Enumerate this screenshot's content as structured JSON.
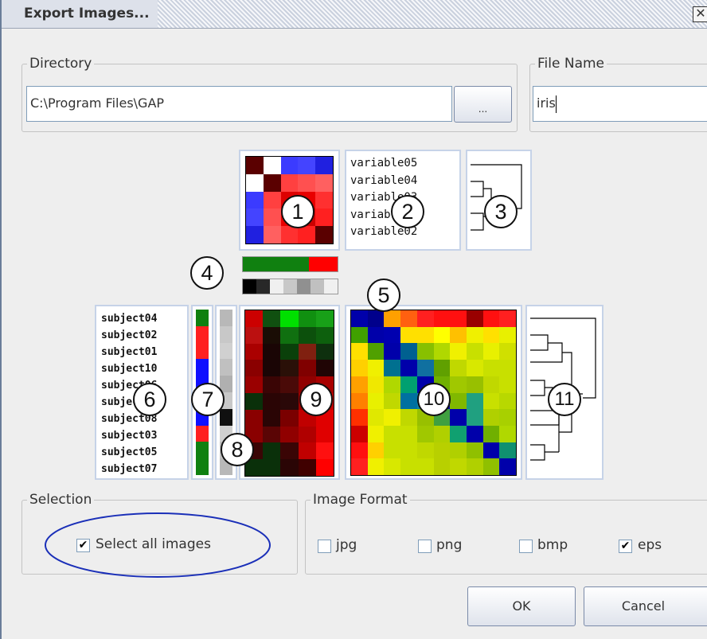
{
  "window": {
    "title": "Export Images...",
    "close_glyph": "✕"
  },
  "directory": {
    "group_label": "Directory",
    "value": "C:\\Program Files\\GAP",
    "browse_label": "..."
  },
  "file_name": {
    "group_label": "File Name",
    "value": "iris"
  },
  "preview": {
    "callouts": [
      "1",
      "2",
      "3",
      "4",
      "5",
      "6",
      "7",
      "8",
      "9",
      "10",
      "11"
    ],
    "variable_labels": [
      "variable05",
      "variable04",
      "variable03",
      "variable01",
      "variable02"
    ],
    "subject_labels": [
      "subject04",
      "subject02",
      "subject01",
      "subject10",
      "subject06",
      "subject09",
      "subject08",
      "subject03",
      "subject05",
      "subject07"
    ],
    "variable_matrix": [
      [
        "#5a0000",
        "#ffffff",
        "#3b3bff",
        "#4444ff",
        "#2020e0"
      ],
      [
        "#ffffff",
        "#5a0000",
        "#ff4040",
        "#ff5050",
        "#ff6060"
      ],
      [
        "#3b3bff",
        "#ff4040",
        "#dd0000",
        "#e80000",
        "#ff3030"
      ],
      [
        "#4444ff",
        "#ff5050",
        "#e80000",
        "#cc0000",
        "#ff2020"
      ],
      [
        "#2020e0",
        "#ff6060",
        "#ff3030",
        "#ff2020",
        "#5a0000"
      ]
    ],
    "color_bar_green_red": [
      "#108010",
      "#108010",
      "#108010",
      "#108010",
      "#108010",
      "#108010",
      "#108010",
      "#ff0000",
      "#ff0000",
      "#ff0000"
    ],
    "color_bar_gray": [
      "#000000",
      "#282828",
      "#f0f0f0",
      "#c8c8c8",
      "#909090",
      "#c0c0c0",
      "#f0f0f0"
    ],
    "subject_group_colors": [
      "#108010",
      "#ff2020",
      "#ff2020",
      "#1010ff",
      "#1010ff",
      "#1010ff",
      "#1010ff",
      "#ff2020",
      "#108010",
      "#108010"
    ],
    "subject_gray_colors": [
      "#b8b8b8",
      "#c8c8c8",
      "#d0d0d0",
      "#c0c0c0",
      "#b0b0b0",
      "#c8c8c8",
      "#101010",
      "#d0d0d0",
      "#c0c0c0",
      "#b8b8b8"
    ],
    "data_matrix": [
      [
        "#cc0000",
        "#105010",
        "#00e000",
        "#109010",
        "#18a018"
      ],
      [
        "#bb1010",
        "#1a0d05",
        "#107010",
        "#0c500c",
        "#0d600d"
      ],
      [
        "#aa0000",
        "#1a0505",
        "#0a400a",
        "#802010",
        "#0e300e"
      ],
      [
        "#8a0000",
        "#1a0505",
        "#2a1008",
        "#800000",
        "#200505"
      ],
      [
        "#9a0000",
        "#3a0505",
        "#4a0a08",
        "#900000",
        "#a80000"
      ],
      [
        "#0a300a",
        "#2a0505",
        "#2a0808",
        "#a00000",
        "#c00000"
      ],
      [
        "#8a0000",
        "#2a0505",
        "#7a0000",
        "#c00000",
        "#e00000"
      ],
      [
        "#8a0000",
        "#5a0505",
        "#900000",
        "#b00000",
        "#e00000"
      ],
      [
        "#3a0505",
        "#0a300a",
        "#3a0505",
        "#c00000",
        "#ff1010"
      ],
      [
        "#0a300a",
        "#0a300a",
        "#2a0505",
        "#400000",
        "#ff0000"
      ]
    ],
    "distance_matrix": [
      [
        "#0000aa",
        "#00008c",
        "#ffa000",
        "#ff6010",
        "#ff2020",
        "#ff1010",
        "#ff1010",
        "#990000",
        "#ff1010",
        "#ff2020"
      ],
      [
        "#40a000",
        "#0000aa",
        "#0000b0",
        "#ffe000",
        "#ffe000",
        "#ffff00",
        "#ffc000",
        "#f0f000",
        "#ffe000",
        "#e8f000"
      ],
      [
        "#ffe000",
        "#50a000",
        "#0000aa",
        "#006090",
        "#88c000",
        "#b0d800",
        "#f0f000",
        "#c8e000",
        "#e8f000",
        "#d0e000"
      ],
      [
        "#ffd000",
        "#f0f000",
        "#007090",
        "#0000aa",
        "#1070a0",
        "#60a000",
        "#c0d800",
        "#d8e800",
        "#c8e000",
        "#c8e000"
      ],
      [
        "#ffa000",
        "#f0e800",
        "#b0d800",
        "#00a070",
        "#0000aa",
        "#70b000",
        "#a0c800",
        "#98c000",
        "#c0d800",
        "#c8e000"
      ],
      [
        "#ff8000",
        "#e8f000",
        "#c0d800",
        "#0070a0",
        "#1080a0",
        "#0000aa",
        "#80b800",
        "#20a080",
        "#c8e000",
        "#b8d800"
      ],
      [
        "#ff3000",
        "#e0e800",
        "#f0f000",
        "#c0d800",
        "#98c000",
        "#40a040",
        "#0000aa",
        "#20a080",
        "#b0d000",
        "#a8d000"
      ],
      [
        "#cc0000",
        "#f0f000",
        "#c8e000",
        "#c8e000",
        "#a0c800",
        "#b0d000",
        "#10a070",
        "#0000aa",
        "#70b000",
        "#b0d800"
      ],
      [
        "#ff1010",
        "#ffd000",
        "#c8e000",
        "#c8e000",
        "#c0d800",
        "#b8d000",
        "#b0d000",
        "#90c000",
        "#0000aa",
        "#109070"
      ],
      [
        "#ff2020",
        "#f0f000",
        "#d8e800",
        "#c8e000",
        "#c8e000",
        "#b8d000",
        "#c0d800",
        "#b0d000",
        "#90c000",
        "#0000aa"
      ]
    ]
  },
  "selection": {
    "group_label": "Selection",
    "select_all_label": "Select all images",
    "select_all_checked": true,
    "check_glyph": "✔"
  },
  "image_format": {
    "group_label": "Image Format",
    "options": [
      {
        "label": "jpg",
        "checked": false
      },
      {
        "label": "png",
        "checked": false
      },
      {
        "label": "bmp",
        "checked": false
      },
      {
        "label": "eps",
        "checked": true
      }
    ]
  },
  "buttons": {
    "ok": "OK",
    "cancel": "Cancel"
  },
  "colors": {
    "highlight_ellipse": "#1a2fb8",
    "border_blue": "#7f9db9"
  }
}
